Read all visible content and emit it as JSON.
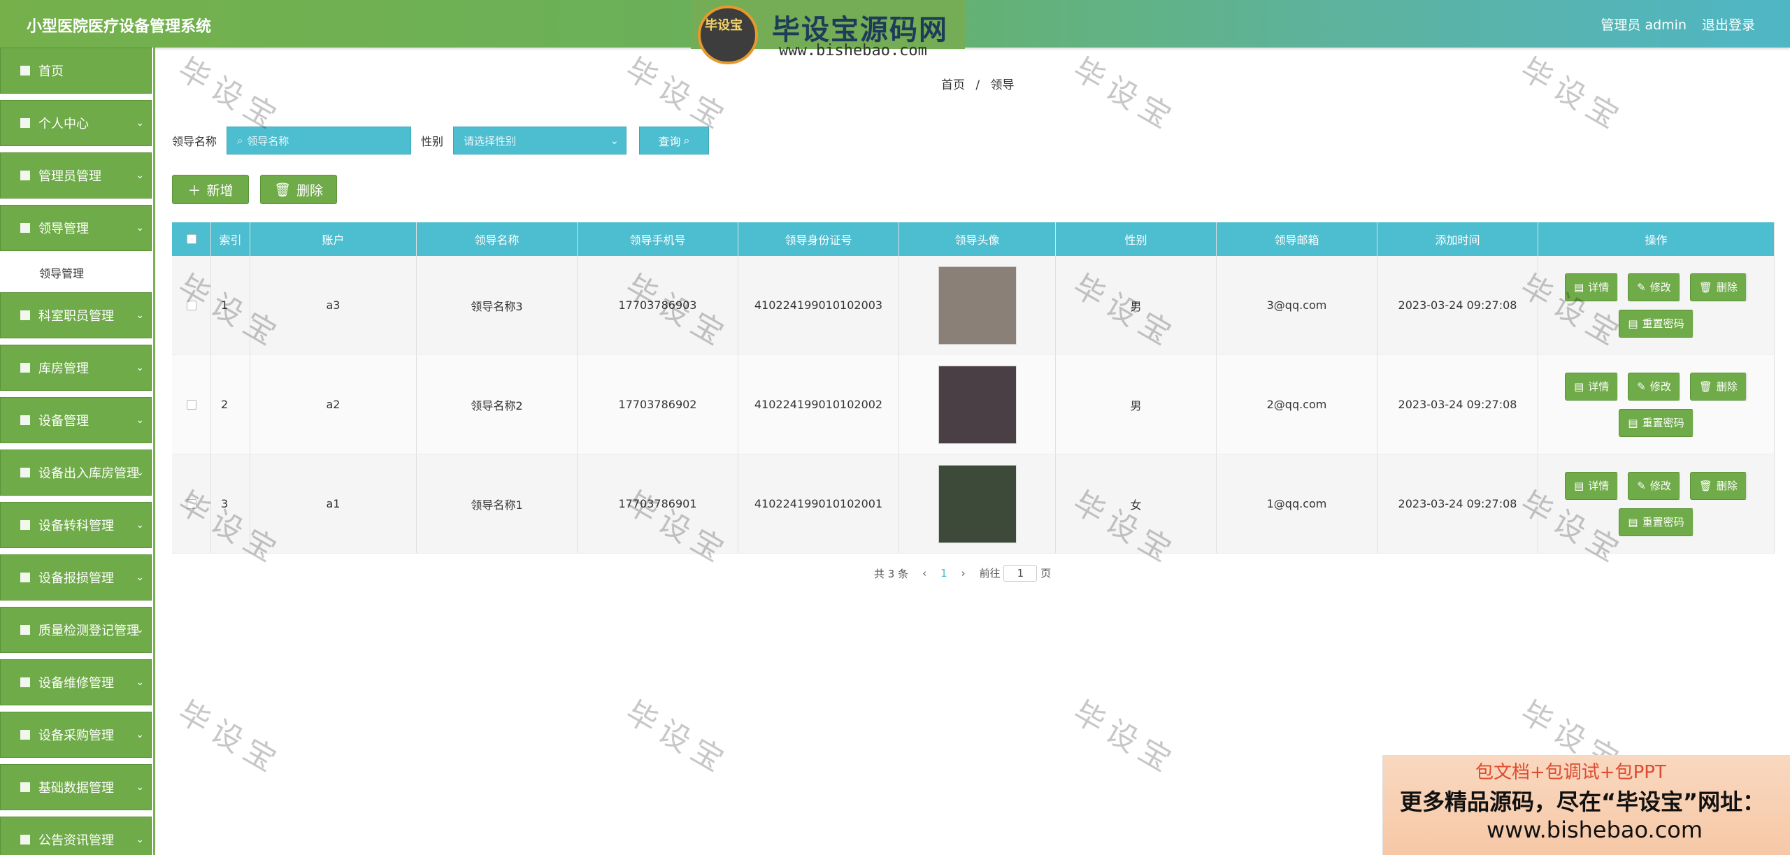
{
  "header": {
    "title": "小型医院医疗设备管理系统",
    "user": "管理员 admin",
    "logout": "退出登录"
  },
  "watermark_logo": {
    "badge_text": "毕设宝",
    "name": "毕设宝源码网",
    "url": "www.bishebao.com"
  },
  "sidebar": {
    "items": [
      {
        "label": "首页",
        "icon": "home-icon"
      },
      {
        "label": "个人中心",
        "icon": "user-icon"
      },
      {
        "label": "管理员管理",
        "icon": "grid-icon"
      },
      {
        "label": "领导管理",
        "icon": "list-icon"
      },
      {
        "label": "领导管理",
        "icon": "",
        "sub": true
      },
      {
        "label": "科室职员管理",
        "icon": "chart-icon"
      },
      {
        "label": "库房管理",
        "icon": "grid-icon"
      },
      {
        "label": "设备管理",
        "icon": "box-icon"
      },
      {
        "label": "设备出入库房管理",
        "icon": "grid-icon"
      },
      {
        "label": "设备转科管理",
        "icon": "chart-icon"
      },
      {
        "label": "设备报损管理",
        "icon": "grid-icon"
      },
      {
        "label": "质量检测登记管理",
        "icon": "chat-icon"
      },
      {
        "label": "设备维修管理",
        "icon": "box-icon"
      },
      {
        "label": "设备采购管理",
        "icon": "flag-icon"
      },
      {
        "label": "基础数据管理",
        "icon": "menu-icon"
      },
      {
        "label": "公告资讯管理",
        "icon": "grid-icon"
      }
    ]
  },
  "breadcrumb": {
    "home": "首页",
    "sep": "/",
    "current": "领导"
  },
  "search": {
    "name_label": "领导名称",
    "name_placeholder": "领导名称",
    "gender_label": "性别",
    "gender_placeholder": "请选择性别",
    "query_btn": "查询"
  },
  "actions": {
    "add": "新增",
    "delete": "删除"
  },
  "table": {
    "columns": [
      "索引",
      "账户",
      "领导名称",
      "领导手机号",
      "领导身份证号",
      "领导头像",
      "性别",
      "领导邮箱",
      "添加时间",
      "操作"
    ],
    "rows": [
      {
        "index": "1",
        "account": "a3",
        "name": "领导名称3",
        "phone": "17703786903",
        "idcard": "410224199010102003",
        "gender": "男",
        "email": "3@qq.com",
        "time": "2023-03-24 09:27:08",
        "avatar_color": "#8a8077"
      },
      {
        "index": "2",
        "account": "a2",
        "name": "领导名称2",
        "phone": "17703786902",
        "idcard": "410224199010102002",
        "gender": "男",
        "email": "2@qq.com",
        "time": "2023-03-24 09:27:08",
        "avatar_color": "#4a3f45"
      },
      {
        "index": "3",
        "account": "a1",
        "name": "领导名称1",
        "phone": "17703786901",
        "idcard": "410224199010102001",
        "gender": "女",
        "email": "1@qq.com",
        "time": "2023-03-24 09:27:08",
        "avatar_color": "#3d4a3a"
      }
    ],
    "ops": {
      "detail": "详情",
      "edit": "修改",
      "delete": "删除",
      "reset": "重置密码"
    }
  },
  "pager": {
    "total": "共 3 条",
    "prev": "‹",
    "page": "1",
    "next": "›",
    "goto": "前往",
    "jump_value": "1",
    "unit": "页"
  },
  "watermark_text": "毕设宝",
  "ad": {
    "line1": "包文档+包调试+包PPT",
    "line2": "更多精品源码，尽在“毕设宝”网址：",
    "line3": "www.bishebao.com"
  },
  "colors": {
    "green": "#6fab48",
    "teal": "#4dbdd0"
  }
}
